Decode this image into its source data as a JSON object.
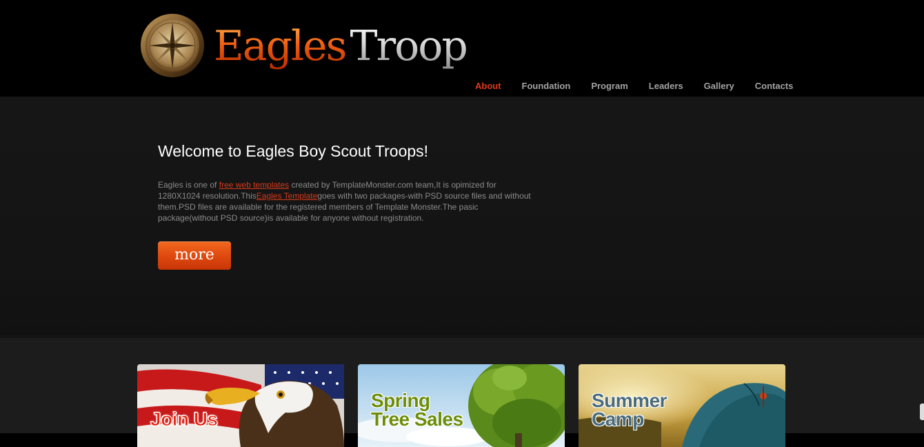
{
  "header": {
    "logo_word1": "Eagles",
    "logo_word2": "Troop",
    "logo_icon": "compass-icon"
  },
  "nav": {
    "items": [
      {
        "label": "About",
        "active": true
      },
      {
        "label": "Foundation",
        "active": false
      },
      {
        "label": "Program",
        "active": false
      },
      {
        "label": "Leaders",
        "active": false
      },
      {
        "label": "Gallery",
        "active": false
      },
      {
        "label": "Contacts",
        "active": false
      }
    ]
  },
  "hero": {
    "title": "Welcome to Eagles Boy Scout Troops!",
    "text_part1": "Eagles is one of ",
    "link1": "free web templates",
    "text_part2": " created by TemplateMonster.com team,It is opimized for 1280X1024 resolution.This",
    "link2": "Eagles Template",
    "text_part3": "goes with two packages-with PSD source files and without them.PSD files are available for the registered members of Template Monster.The pasic package(without PSD source)is available for anyone without registration.",
    "more_label": "more"
  },
  "cards": [
    {
      "line1": "Join Us",
      "line2": ""
    },
    {
      "line1": "Spring",
      "line2": "Tree Sales"
    },
    {
      "line1": "Summer",
      "line2": "Camp"
    }
  ],
  "colors": {
    "accent": "#e33a1c",
    "nav_text": "#a3a3a3",
    "button": "#e04a10"
  }
}
